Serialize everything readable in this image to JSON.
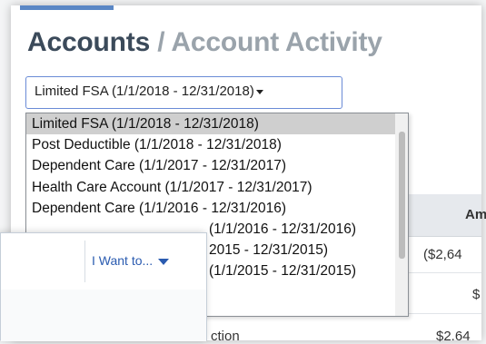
{
  "page": {
    "title_main": "Accounts",
    "title_separator": " / ",
    "title_sub": "Account Activity"
  },
  "plan_select": {
    "value": "Limited FSA (1/1/2018 - 12/31/2018)"
  },
  "dropdown": {
    "options": [
      "Limited FSA (1/1/2018 - 12/31/2018)",
      "Post Deductible (1/1/2018 - 12/31/2018)",
      "Dependent Care (1/1/2017 - 12/31/2017)",
      "Health Care Account (1/1/2017 - 12/31/2017)",
      "Dependent Care (1/1/2016 - 12/31/2016)",
      "(1/1/2016 - 12/31/2016)",
      "2015 - 12/31/2015)",
      "(1/1/2015 - 12/31/2015)"
    ],
    "selected_index": 0
  },
  "table": {
    "amount_header": "Am",
    "amount_row1": "($2,64",
    "amount_row2": "$",
    "amount_row3": "$2.64",
    "description_partial": "ction"
  },
  "left_panel": {
    "i_want_label": "I Want to..."
  },
  "colors": {
    "accent": "#5a87c5",
    "title": "#3b4a5a",
    "title_sub": "#9aa3ab",
    "link": "#2a5bb0",
    "select_border": "#6a8bd6"
  }
}
